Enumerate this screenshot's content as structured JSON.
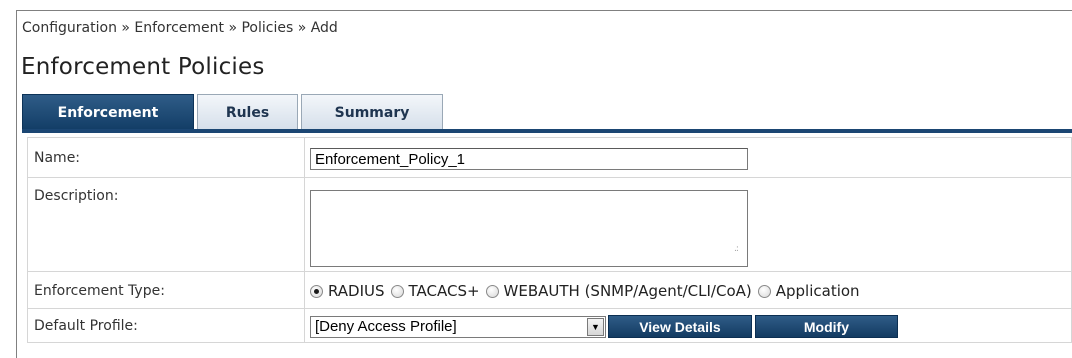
{
  "breadcrumb": {
    "text": "Configuration » Enforcement » Policies » Add"
  },
  "page": {
    "title": "Enforcement Policies"
  },
  "tabs": [
    {
      "label": "Enforcement",
      "active": true
    },
    {
      "label": "Rules",
      "active": false
    },
    {
      "label": "Summary",
      "active": false
    }
  ],
  "form": {
    "name": {
      "label": "Name:",
      "value": "Enforcement_Policy_1"
    },
    "description": {
      "label": "Description:",
      "value": ""
    },
    "enforcement_type": {
      "label": "Enforcement Type:",
      "options": [
        {
          "label": "RADIUS",
          "checked": true
        },
        {
          "label": "TACACS+",
          "checked": false
        },
        {
          "label": "WEBAUTH (SNMP/Agent/CLI/CoA)",
          "checked": false
        },
        {
          "label": "Application",
          "checked": false
        }
      ]
    },
    "default_profile": {
      "label": "Default Profile:",
      "selected": "[Deny Access Profile]",
      "view_details_label": "View Details",
      "modify_label": "Modify"
    }
  },
  "colors": {
    "tab_active": "#1b4673",
    "button": "#1f4a75",
    "border": "#d6d6d6"
  }
}
